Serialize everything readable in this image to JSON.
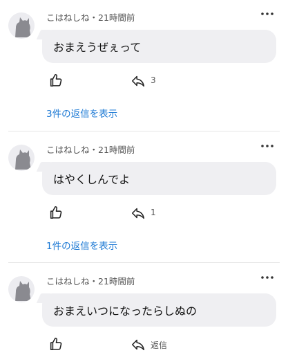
{
  "comments": [
    {
      "author": "こはねしね",
      "sep": "・",
      "time": "21時間前",
      "text": "おまえうぜぇって",
      "reply_label": "3",
      "view_replies": "3件の返信を表示"
    },
    {
      "author": "こはねしね",
      "sep": "・",
      "time": "21時間前",
      "text": "はやくしんでよ",
      "reply_label": "1",
      "view_replies": "1件の返信を表示"
    },
    {
      "author": "こはねしね",
      "sep": "・",
      "time": "21時間前",
      "text": "おまえいつになったらしぬの",
      "reply_label": "返信"
    }
  ],
  "icons": {
    "avatar": "cat-silhouette-icon",
    "more": "more-horizontal-icon",
    "like": "thumbs-up-icon",
    "reply": "reply-arrow-icon"
  },
  "colors": {
    "link": "#1b78d4",
    "bubble": "#efeff2"
  }
}
